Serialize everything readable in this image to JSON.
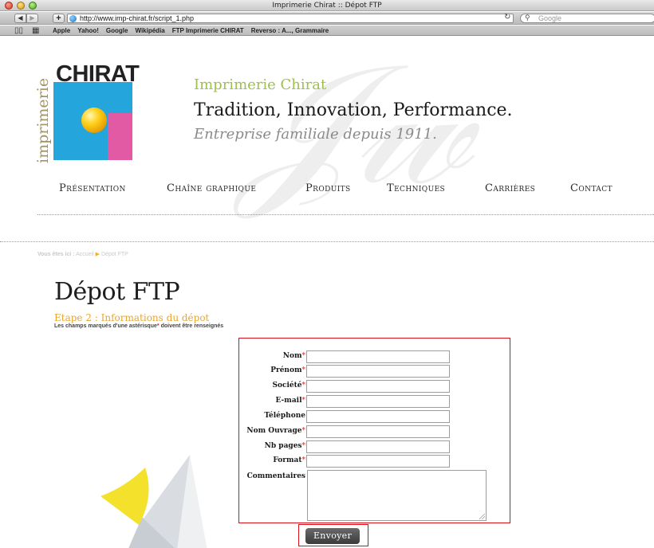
{
  "browser": {
    "window_title": "Imprimerie Chirat :: Dépot FTP",
    "url": "http://www.imp-chirat.fr/script_1.php",
    "search_placeholder": "Google",
    "bookmarks": [
      "Apple",
      "Yahoo!",
      "Google",
      "Wikipédia",
      "FTP Imprimerie CHIRAT",
      "Reverso : A..., Grammaire"
    ]
  },
  "logo": {
    "wordmark": "CHIRAT",
    "vertical_text": "imprimerie",
    "colors": {
      "blue": "#24a6dd",
      "pink": "#e35aa4",
      "yellow": "#ffd11a"
    }
  },
  "header": {
    "company": "Imprimerie Chirat",
    "slogan": "Tradition, Innovation, Performance.",
    "since": "Entreprise familiale depuis 1911."
  },
  "nav": {
    "items": [
      "Présentation",
      "Chaîne graphique",
      "Produits",
      "Techniques",
      "Carrières",
      "Contact"
    ]
  },
  "breadcrumb": {
    "prefix": "Vous êtes ici :",
    "home": "Accueil",
    "separator": "▶",
    "current": "Dépot FTP"
  },
  "main": {
    "title": "Dépot FTP",
    "step": "Etape 2 : Informations du dépot",
    "required_note_before": "Les champs marqués d'une astérisque",
    "required_note_star": "*",
    "required_note_after": "doivent être renseignés"
  },
  "form": {
    "fields": [
      {
        "label": "Nom",
        "required": "*",
        "value": ""
      },
      {
        "label": "Prénom",
        "required": "*",
        "value": ""
      },
      {
        "label": "Société",
        "required": "*",
        "value": ""
      },
      {
        "label": "E-mail",
        "required": "*",
        "value": ""
      },
      {
        "label": "Téléphone",
        "required": "",
        "value": ""
      },
      {
        "label": "Nom Ouvrage",
        "required": "*",
        "value": ""
      },
      {
        "label": "Nb pages",
        "required": "*",
        "value": ""
      },
      {
        "label": "Format",
        "required": "*",
        "value": ""
      }
    ],
    "comments_label": "Commentaires",
    "submit_label": "Envoyer",
    "accent_color": "#d9101a"
  }
}
